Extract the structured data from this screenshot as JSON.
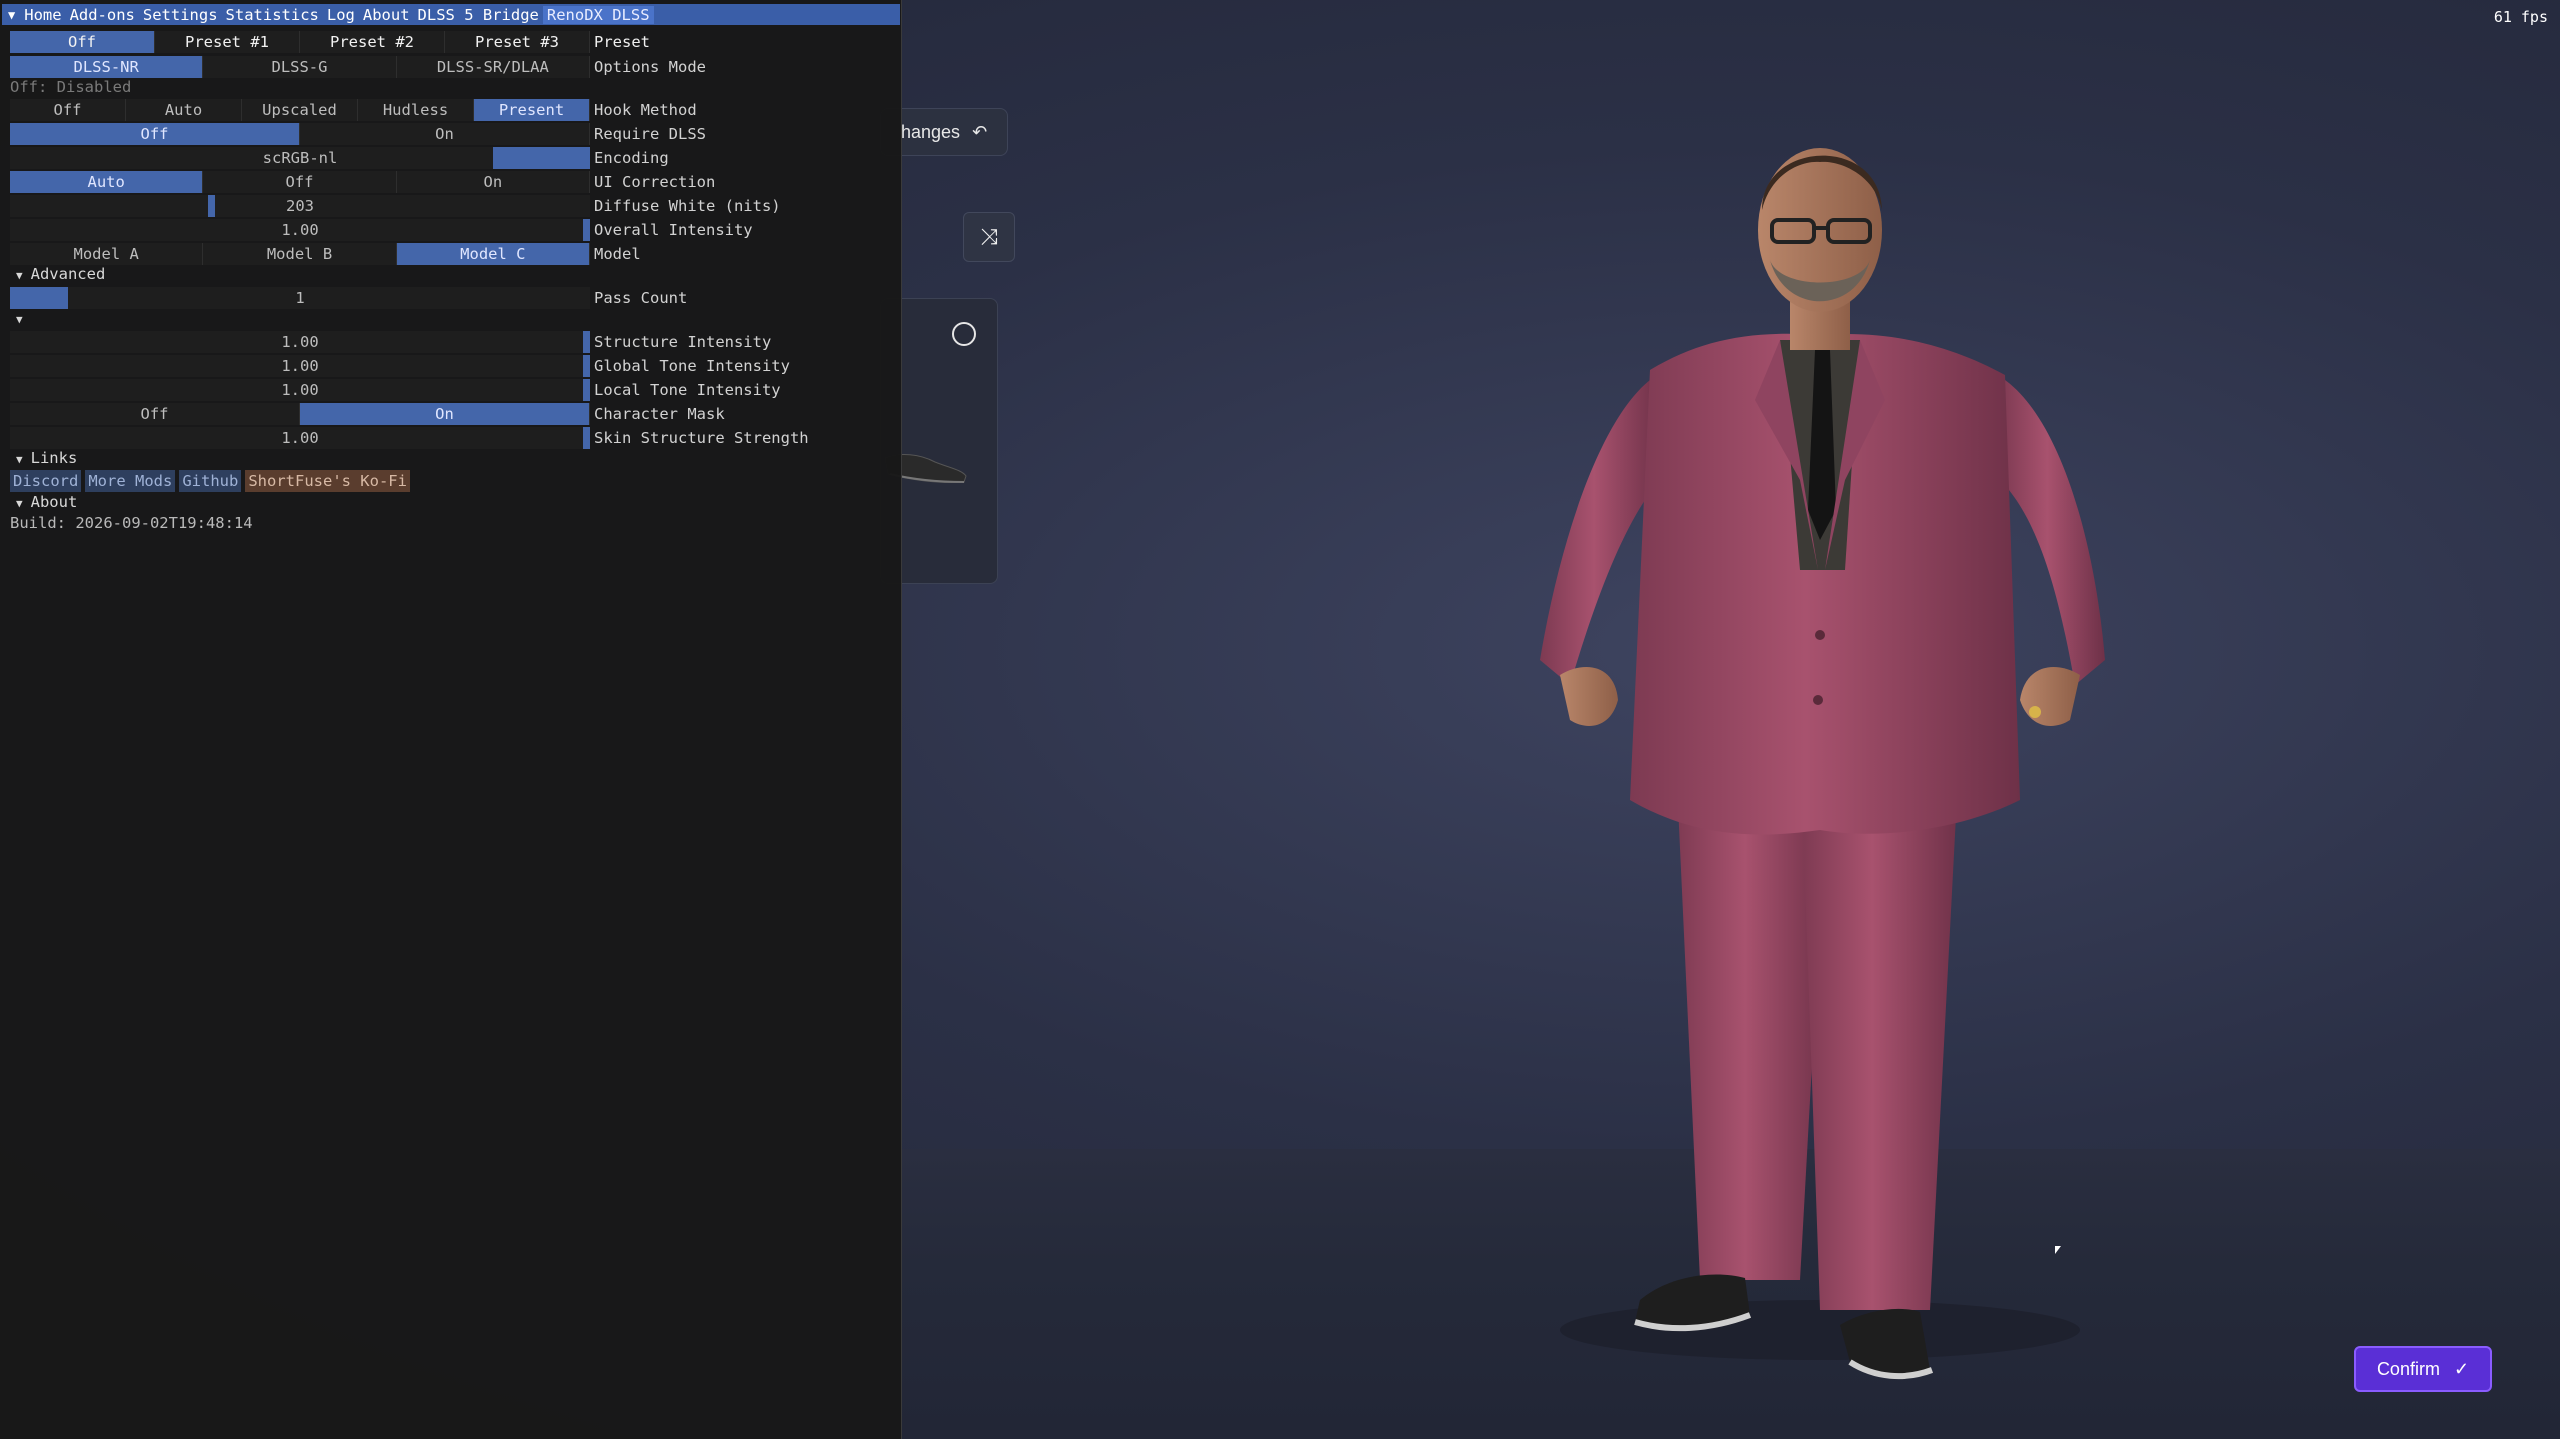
{
  "fps": "61 fps",
  "menu": {
    "items": [
      "Home",
      "Add-ons",
      "Settings",
      "Statistics",
      "Log",
      "About",
      "DLSS 5 Bridge",
      "RenoDX DLSS"
    ]
  },
  "settings": {
    "preset": {
      "label": "Preset",
      "options": [
        "Off",
        "Preset #1",
        "Preset #2",
        "Preset #3"
      ],
      "selected": 0
    },
    "options_mode": {
      "label": "Options Mode",
      "options": [
        "DLSS-NR",
        "DLSS-G",
        "DLSS-SR/DLAA"
      ],
      "selected": 0
    },
    "off_note": "Off: Disabled",
    "hook_method": {
      "label": "Hook Method",
      "options": [
        "Off",
        "Auto",
        "Upscaled",
        "Hudless",
        "Present"
      ],
      "selected": 4
    },
    "require_dlss": {
      "label": "Require DLSS",
      "options": [
        "Off",
        "On"
      ],
      "selected": 0
    },
    "encoding": {
      "label": "Encoding",
      "value": "scRGB-nl"
    },
    "ui_correction": {
      "label": "UI Correction",
      "options": [
        "Auto",
        "Off",
        "On"
      ],
      "selected": 0
    },
    "diffuse_white": {
      "label": "Diffuse White (nits)",
      "value": "203"
    },
    "overall_intensity": {
      "label": "Overall Intensity",
      "value": "1.00"
    },
    "model": {
      "label": "Model",
      "options": [
        "Model A",
        "Model B",
        "Model C"
      ],
      "selected": 2
    },
    "advanced_header": "Advanced",
    "pass_count": {
      "label": "Pass Count",
      "value": "1"
    },
    "structure_intensity": {
      "label": "Structure Intensity",
      "value": "1.00"
    },
    "global_tone_intensity": {
      "label": "Global Tone Intensity",
      "value": "1.00"
    },
    "local_tone_intensity": {
      "label": "Local Tone Intensity",
      "value": "1.00"
    },
    "character_mask": {
      "label": "Character Mask",
      "options": [
        "Off",
        "On"
      ],
      "selected": 1
    },
    "skin_structure_strength": {
      "label": "Skin Structure Strength",
      "value": "1.00"
    },
    "links_header": "Links",
    "links": [
      "Discord",
      "More Mods",
      "Github",
      "ShortFuse's Ko-Fi"
    ],
    "about_header": "About",
    "build": "Build: 2026-09-02T19:48:14"
  },
  "game_ui": {
    "changes_label": "hanges",
    "confirm_label": "Confirm"
  },
  "colors": {
    "menu_bar": "#3a5ea8",
    "selected": "#4466aa",
    "confirm": "#5a2fd6",
    "suit": "#a8526e"
  }
}
